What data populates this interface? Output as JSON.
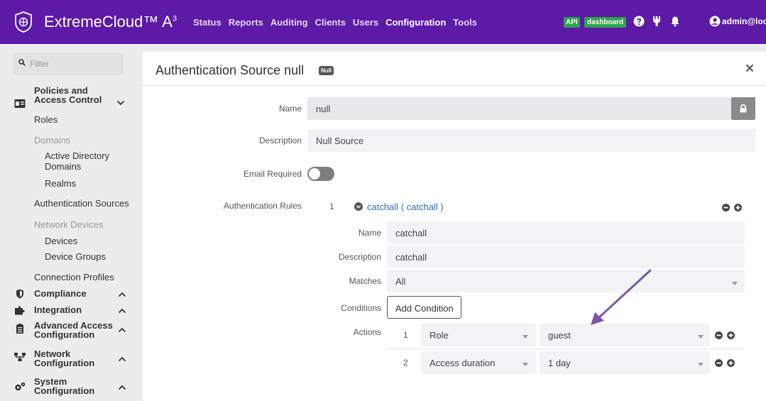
{
  "header": {
    "brand": "ExtremeCloud",
    "brand_tm": "™",
    "brand_suffix": " A",
    "brand_sup": "3",
    "nav": [
      "Status",
      "Reports",
      "Auditing",
      "Clients",
      "Users",
      "Configuration",
      "Tools"
    ],
    "active_nav": "Configuration",
    "api_label": "API",
    "dashboard_label": "dashboard",
    "user": "admin@local",
    "accent": "#5c1aa6"
  },
  "sidebar": {
    "filter_placeholder": "Filter",
    "sections": {
      "policies": "Policies and Access Control",
      "compliance": "Compliance",
      "integration": "Integration",
      "advanced": "Advanced Access Configuration",
      "network": "Network Configuration",
      "system": "System Configuration"
    },
    "items": {
      "roles": "Roles",
      "domains": "Domains",
      "active_directory": "Active Directory Domains",
      "realms": "Realms",
      "auth_sources": "Authentication Sources",
      "network_devices": "Network Devices",
      "devices": "Devices",
      "device_groups": "Device Groups",
      "connection_profiles": "Connection Profiles"
    }
  },
  "panel": {
    "title": "Authentication Source null",
    "badge": "Null",
    "name_label": "Name",
    "name_value": "null",
    "description_label": "Description",
    "description_value": "Null Source",
    "email_required_label": "Email Required",
    "auth_rules_label": "Authentication Rules",
    "rule": {
      "index": "1",
      "link": "catchall ( catchall )",
      "name_label": "Name",
      "name_value": "catchall",
      "description_label": "Description",
      "description_value": "catchall",
      "matches_label": "Matches",
      "matches_value": "All",
      "conditions_label": "Conditions",
      "add_condition": "Add Condition",
      "actions_label": "Actions",
      "actions": [
        {
          "index": "1",
          "type": "Role",
          "value": "guest"
        },
        {
          "index": "2",
          "type": "Access duration",
          "value": "1 day"
        }
      ]
    }
  }
}
